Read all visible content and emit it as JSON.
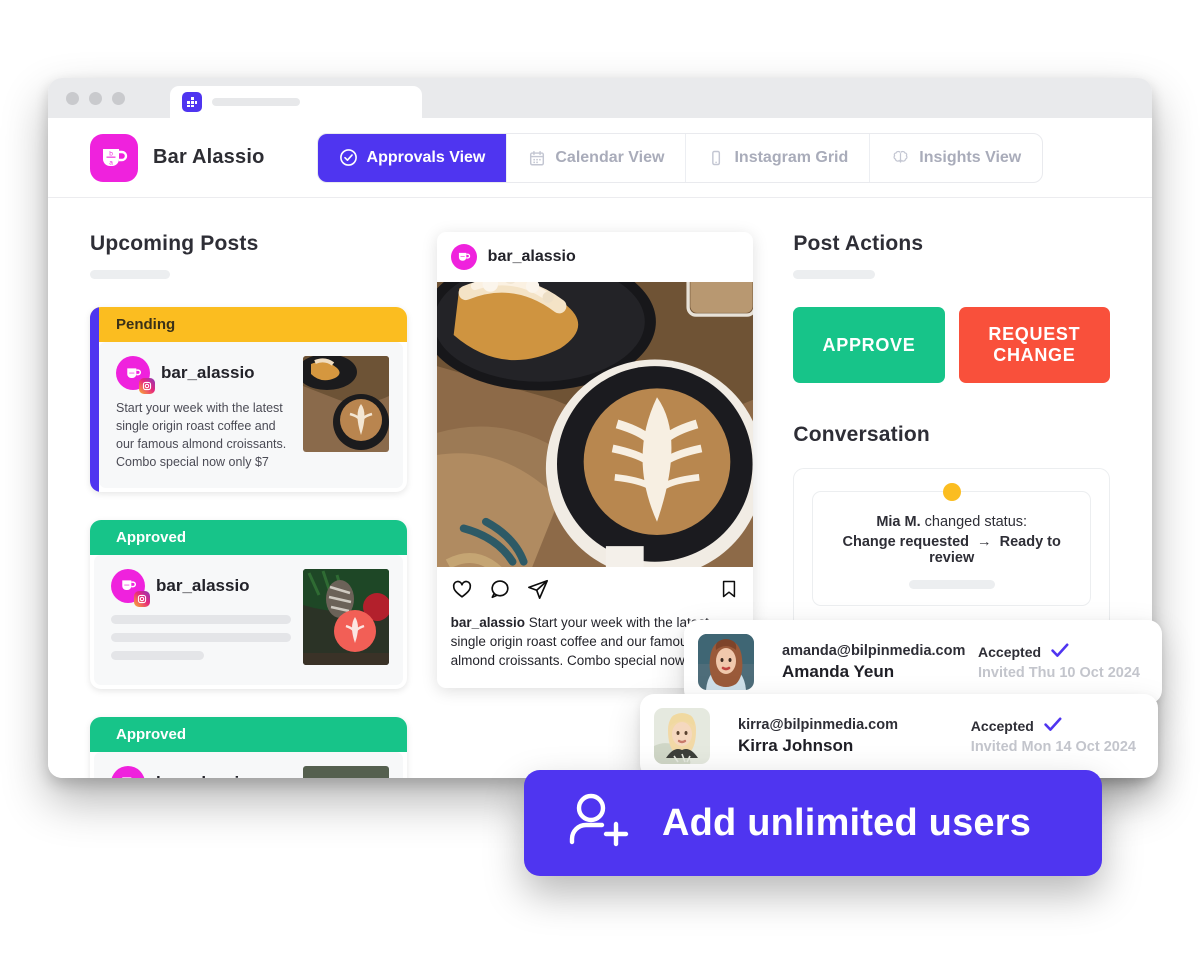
{
  "browser": {
    "tab_favicon_icon": "app-grid-icon",
    "window_controls": [
      "close",
      "minimize",
      "maximize"
    ]
  },
  "header": {
    "brand_name": "Bar Alassio",
    "brand_logo_icon": "coffee-cup-logo",
    "tabs": [
      {
        "label": "Approvals View",
        "icon": "check-circle-icon",
        "active": true
      },
      {
        "label": "Calendar View",
        "icon": "calendar-icon",
        "active": false
      },
      {
        "label": "Instagram Grid",
        "icon": "mobile-phone-icon",
        "active": false
      },
      {
        "label": "Insights View",
        "icon": "brain-icon",
        "active": false
      }
    ]
  },
  "left_panel": {
    "title": "Upcoming Posts",
    "posts": [
      {
        "status": "Pending",
        "handle": "bar_alassio",
        "caption": "Start your week with the latest single origin roast coffee and our famous almond croissants. Combo special now only $7",
        "thumb": "croissant-latte-photo",
        "selected": true
      },
      {
        "status": "Approved",
        "handle": "bar_alassio",
        "caption": "",
        "thumb": "pinecone-apple-latte-photo",
        "selected": false
      },
      {
        "status": "Approved",
        "handle": "bar_alassio",
        "caption": "",
        "thumb": "latte-art-photo",
        "selected": false
      }
    ]
  },
  "center_panel": {
    "post": {
      "handle": "bar_alassio",
      "photo": "croissant-and-latte-on-wooden-table",
      "actions": [
        "like-icon",
        "comment-icon",
        "share-icon",
        "bookmark-icon"
      ],
      "caption_author": "bar_alassio",
      "caption_text": "Start your week with the latest single origin roast coffee and our famous almond croissants. Combo special now only $7"
    }
  },
  "right_panel": {
    "actions_title": "Post Actions",
    "approve_label": "APPROVE",
    "request_change_label": "REQUEST CHANGE",
    "conversation_title": "Conversation",
    "conversation_entry": {
      "actor": "Mia M.",
      "verb": "changed status:",
      "from_status": "Change requested",
      "arrow": "→",
      "to_status": "Ready to review"
    }
  },
  "user_cards": [
    {
      "avatar": "amanda-portrait",
      "email": "amanda@bilpinmedia.com",
      "name": "Amanda Yeun",
      "status": "Accepted",
      "status_icon": "check-icon",
      "invited": "Invited Thu 10 Oct 2024"
    },
    {
      "avatar": "kirra-portrait",
      "email": "kirra@bilpinmedia.com",
      "name": "Kirra Johnson",
      "status": "Accepted",
      "status_icon": "check-icon",
      "invited": "Invited Mon 14 Oct 2024"
    }
  ],
  "cta": {
    "label": "Add unlimited users",
    "icon": "add-user-icon"
  },
  "colors": {
    "accent": "#4f35f0",
    "brand_magenta": "#ef22dd",
    "approve_green": "#17c489",
    "request_red": "#f9503b",
    "pending_yellow": "#fbbd20"
  }
}
